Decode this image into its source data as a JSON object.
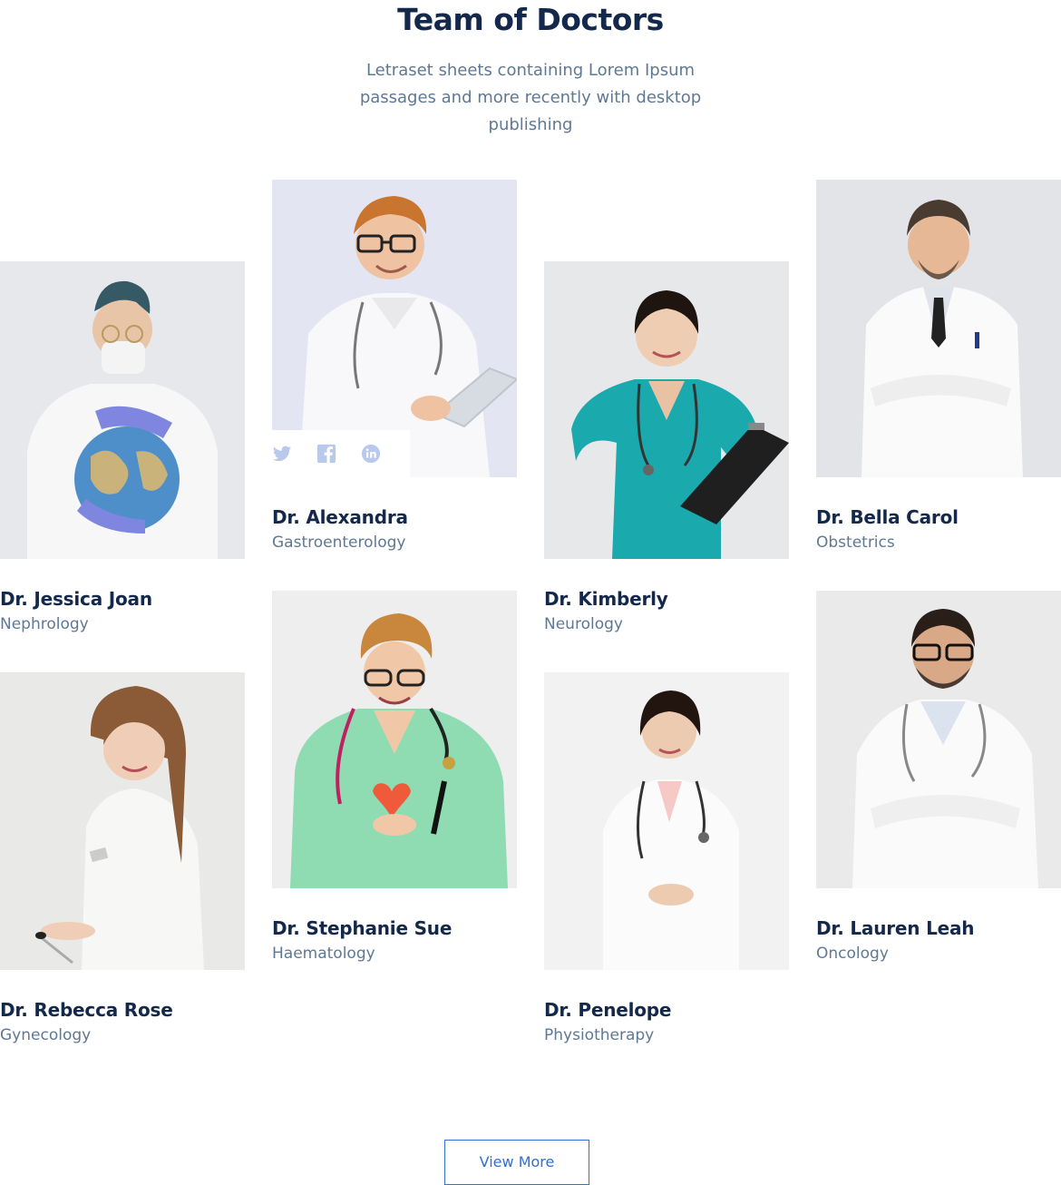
{
  "section": {
    "title": "Team of Doctors",
    "subtitle": "Letraset sheets containing Lorem Ipsum passages and more recently with desktop publishing"
  },
  "doctors": [
    {
      "name": "Dr. Jessica Joan",
      "specialty": "Nephrology"
    },
    {
      "name": "Dr. Alexandra",
      "specialty": "Gastroenterology"
    },
    {
      "name": "Dr. Kimberly",
      "specialty": "Neurology"
    },
    {
      "name": "Dr. Bella Carol",
      "specialty": "Obstetrics"
    },
    {
      "name": "Dr. Rebecca Rose",
      "specialty": "Gynecology"
    },
    {
      "name": "Dr. Stephanie Sue",
      "specialty": "Haematology"
    },
    {
      "name": "Dr. Penelope",
      "specialty": "Physiotherapy"
    },
    {
      "name": "Dr. Lauren Leah",
      "specialty": "Oncology"
    }
  ],
  "social_icons": [
    "twitter-icon",
    "facebook-icon",
    "linkedin-icon"
  ],
  "view_more_label": "View More",
  "colors": {
    "heading": "#13284a",
    "muted_text": "#5f7894",
    "accent": "#2f6fd6",
    "social_icon": "#b9c9ec"
  }
}
